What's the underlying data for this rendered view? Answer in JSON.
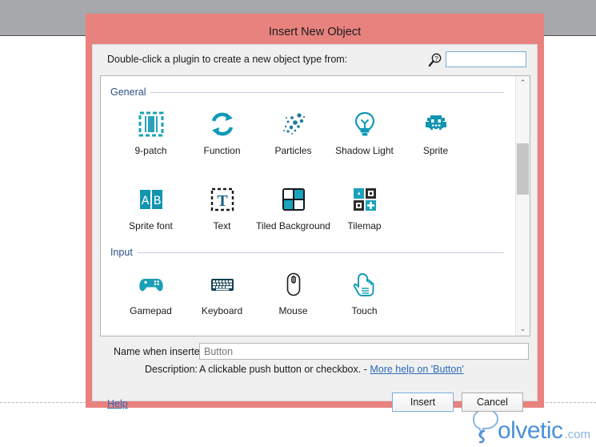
{
  "window": {
    "title": "Insert New Object",
    "accent_border_color": "#e8827f",
    "body_bg_color": "#f0f0f0"
  },
  "prompt": {
    "label": "Double-click a plugin to create a new object type from:",
    "search_icon": "search-help-icon",
    "search_value": "",
    "search_placeholder": ""
  },
  "plugin_list": {
    "groups": [
      {
        "title": "General",
        "items": [
          {
            "label": "9-patch",
            "icon": "nine-patch-icon"
          },
          {
            "label": "Function",
            "icon": "function-loop-icon"
          },
          {
            "label": "Particles",
            "icon": "particles-icon"
          },
          {
            "label": "Shadow Light",
            "icon": "lightbulb-icon"
          },
          {
            "label": "Sprite",
            "icon": "sprite-invader-icon"
          },
          {
            "label": "Sprite font",
            "icon": "sprite-font-icon"
          },
          {
            "label": "Text",
            "icon": "text-icon"
          },
          {
            "label": "Tiled Background",
            "icon": "tiled-background-icon"
          },
          {
            "label": "Tilemap",
            "icon": "tilemap-icon"
          }
        ]
      },
      {
        "title": "Input",
        "items": [
          {
            "label": "Gamepad",
            "icon": "gamepad-icon"
          },
          {
            "label": "Keyboard",
            "icon": "keyboard-icon"
          },
          {
            "label": "Mouse",
            "icon": "mouse-icon"
          },
          {
            "label": "Touch",
            "icon": "touch-hand-icon"
          }
        ]
      }
    ],
    "scrollbar": {
      "up_arrow": "⌃",
      "down_arrow": "⌄"
    }
  },
  "details": {
    "name_label": "Name when inserted:",
    "name_value": "Button",
    "description_label": "Description:",
    "description_text": "A clickable push button or checkbox. -",
    "description_link": "More help on 'Button'"
  },
  "footer": {
    "help_link": "Help",
    "insert_label": "Insert",
    "cancel_label": "Cancel"
  },
  "watermark": {
    "name": "olvetic",
    "suffix": ".com",
    "color": "#4a90d9"
  }
}
